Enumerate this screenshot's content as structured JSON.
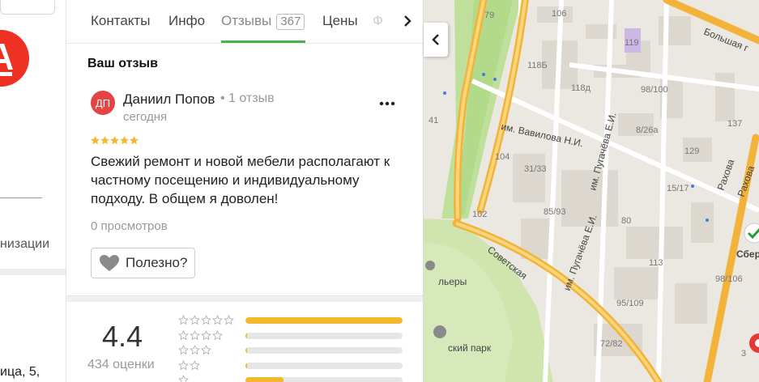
{
  "left": {
    "org_text": "низации",
    "address_text": "ица, 5,"
  },
  "tabs": [
    {
      "label": "Контакты"
    },
    {
      "label": "Инфо"
    },
    {
      "label": "Отзывы",
      "count": "367"
    },
    {
      "label": "Цены"
    },
    {
      "label": "Ф"
    }
  ],
  "review": {
    "section_title": "Ваш отзыв",
    "avatar_initials": "ДП",
    "author": "Даниил Попов",
    "author_meta": "• 1 отзыв",
    "date": "сегодня",
    "stars": 5,
    "text": "Свежий ремонт и новой мебели располагают к частному посещению и индивидуальному подходу. В общем я доволен!",
    "views": "0 просмотров",
    "helpful_label": "Полезно?"
  },
  "rating": {
    "value": "4.4",
    "count_label": "434 оценки",
    "distribution": [
      {
        "stars": 5,
        "fraction": 1.0
      },
      {
        "stars": 4,
        "fraction": 0.01
      },
      {
        "stars": 3,
        "fraction": 0.01
      },
      {
        "stars": 2,
        "fraction": 0.01
      },
      {
        "stars": 1,
        "fraction": 0.24
      }
    ]
  },
  "map": {
    "labels": {
      "street_vavilova": "им. Вавилова Н.И.",
      "street_sovetskaya": "Советская",
      "street_pugacheva": "им. Пугачёва Е.И.",
      "street_pugacheva_2": "им. Пугачёва Е.И.",
      "street_rakhova_1": "Рахова",
      "street_rakhova_2": "Рахова",
      "street_bolshaya": "Большая г",
      "park": "ский парк",
      "area": "льеры",
      "bank": "Сбер"
    },
    "house_numbers": [
      "79",
      "106",
      "119",
      "118Б",
      "118д",
      "98/100",
      "41",
      "8/26а",
      "137",
      "104",
      "129",
      "31/33",
      "15/17",
      "102",
      "85/93",
      "80",
      "113",
      "98/106",
      "95/109",
      "72/82",
      "3"
    ]
  },
  "colors": {
    "accent_tab": "#4caf50",
    "star": "#f4b92b",
    "avatar": "#e64444",
    "road_major": "#f3b23a",
    "park": "#c9e3a7"
  },
  "icons": {
    "logo": "alfa-logo-icon",
    "more": "more-dots-icon",
    "next": "chevron-right-icon",
    "collapse": "chevron-left-icon",
    "helpful": "heart-icon"
  }
}
